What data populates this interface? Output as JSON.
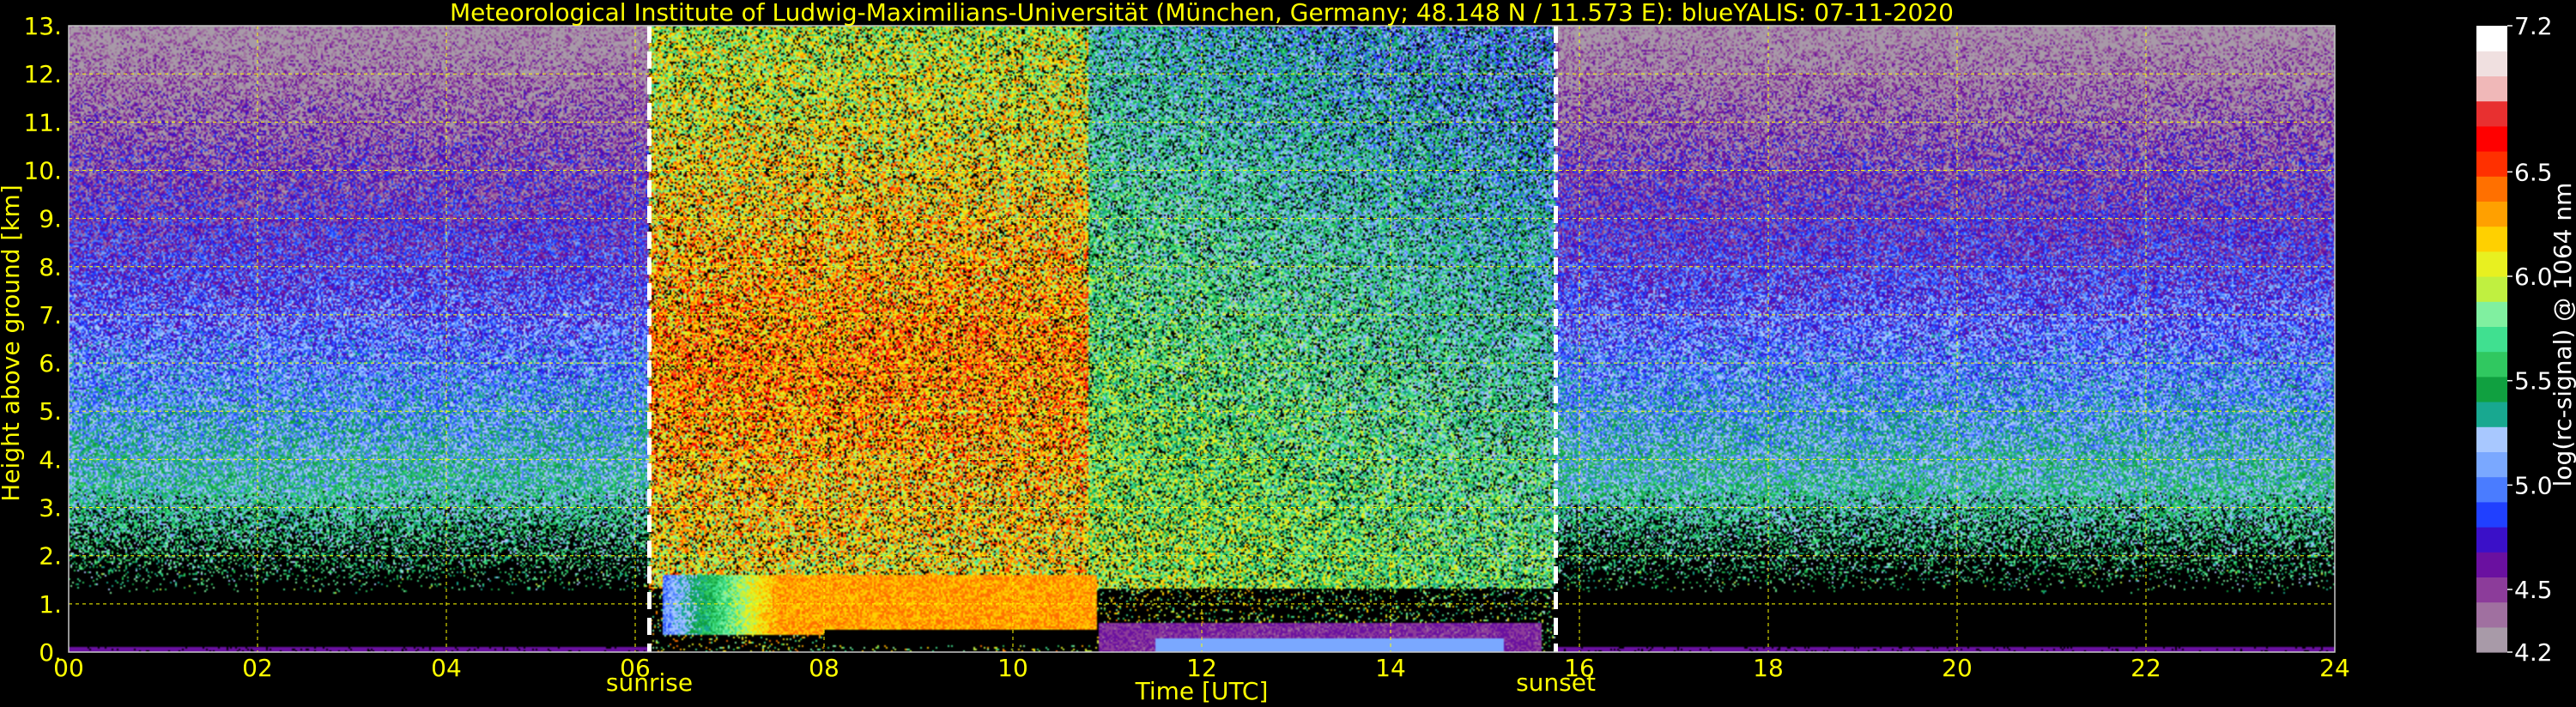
{
  "chart_data": {
    "type": "heatmap",
    "title": "Meteorological Institute of Ludwig-Maximilians-Universität (München, Germany; 48.148 N / 11.573 E):    blueYALIS: 07-11-2020",
    "xlabel": "Time [UTC]",
    "ylabel": "Height above ground [km]",
    "xlim": [
      0,
      24
    ],
    "ylim": [
      0,
      13
    ],
    "x_ticks": [
      "00",
      "02",
      "04",
      "06",
      "08",
      "10",
      "12",
      "14",
      "16",
      "18",
      "20",
      "22",
      "24"
    ],
    "y_ticks": [
      "0.",
      "1.",
      "2.",
      "3.",
      "4.",
      "5.",
      "6.",
      "7.",
      "8.",
      "9.",
      "10.",
      "11.",
      "12.",
      "13."
    ],
    "grid": true,
    "grid_color": "#ffff00",
    "background": "#000000",
    "events": [
      {
        "name": "sunrise",
        "time": 6.15
      },
      {
        "name": "sunset",
        "time": 15.75
      }
    ],
    "colorbar": {
      "label": "log(rc-signal) @ 1064 nm",
      "range": [
        4.2,
        7.2
      ],
      "tick_labels": [
        "4.2",
        "4.5",
        "5.0",
        "5.5",
        "6.0",
        "6.5",
        "7.2"
      ],
      "tick_values": [
        4.2,
        4.5,
        5.0,
        5.5,
        6.0,
        6.5,
        7.2
      ],
      "colors": [
        "#a89aa8",
        "#a070a0",
        "#8c3c9a",
        "#6a10a0",
        "#3a10c8",
        "#2040ff",
        "#4a7cff",
        "#7aa8ff",
        "#a8c8ff",
        "#18a890",
        "#10a040",
        "#30c860",
        "#40e090",
        "#80f0a0",
        "#c0f040",
        "#e8f020",
        "#ffd000",
        "#ffa000",
        "#ff7000",
        "#ff3000",
        "#ff0000",
        "#e83030",
        "#f0b8b8",
        "#f0e0e0",
        "#ffffff"
      ]
    }
  }
}
